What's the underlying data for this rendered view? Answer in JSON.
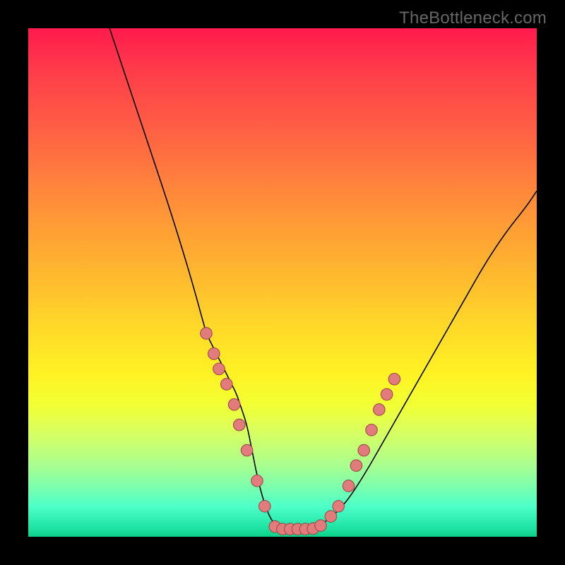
{
  "watermark": "TheBottleneck.com",
  "colors": {
    "background": "#000000",
    "curve": "#000000",
    "dot_fill": "#e27b7c",
    "dot_stroke": "#9c4a4a",
    "gradient_top": "#ff1a4d",
    "gradient_bottom": "#0dd189"
  },
  "chart_data": {
    "type": "line",
    "title": "",
    "xlabel": "",
    "ylabel": "",
    "xlim": [
      0,
      100
    ],
    "ylim": [
      0,
      100
    ],
    "series": [
      {
        "name": "bottleneck-curve",
        "x": [
          16,
          20,
          24,
          28,
          32,
          35,
          35.5,
          36,
          37,
          38,
          39,
          40,
          41,
          42,
          43,
          44,
          45,
          46,
          47,
          48,
          49,
          50,
          52,
          55,
          58,
          62,
          66,
          70,
          74,
          78,
          82,
          86,
          90,
          94,
          98,
          100
        ],
        "values": [
          100,
          88,
          76,
          64,
          51,
          40,
          39,
          38,
          36,
          34,
          32,
          30,
          28,
          25,
          22,
          17,
          12,
          8,
          5,
          3,
          2,
          1.5,
          1.5,
          1.5,
          2.5,
          6,
          12,
          19,
          26,
          33,
          40,
          47,
          54,
          60,
          65,
          68
        ]
      }
    ],
    "points": [
      {
        "name": "left-dot-1",
        "x": 35.0,
        "y": 40
      },
      {
        "name": "left-dot-2",
        "x": 36.5,
        "y": 36
      },
      {
        "name": "left-dot-3",
        "x": 37.5,
        "y": 33
      },
      {
        "name": "left-dot-4",
        "x": 39.0,
        "y": 30
      },
      {
        "name": "left-dot-5",
        "x": 40.5,
        "y": 26
      },
      {
        "name": "left-dot-6",
        "x": 41.5,
        "y": 22
      },
      {
        "name": "left-dot-7",
        "x": 43.0,
        "y": 17
      },
      {
        "name": "left-dot-8",
        "x": 45.0,
        "y": 11
      },
      {
        "name": "left-dot-9",
        "x": 46.5,
        "y": 6
      },
      {
        "name": "flat-dot-1",
        "x": 48.5,
        "y": 2
      },
      {
        "name": "flat-dot-2",
        "x": 50.0,
        "y": 1.5
      },
      {
        "name": "flat-dot-3",
        "x": 51.5,
        "y": 1.5
      },
      {
        "name": "flat-dot-4",
        "x": 53.0,
        "y": 1.5
      },
      {
        "name": "flat-dot-5",
        "x": 54.5,
        "y": 1.5
      },
      {
        "name": "flat-dot-6",
        "x": 56.0,
        "y": 1.6
      },
      {
        "name": "flat-dot-7",
        "x": 57.5,
        "y": 2.2
      },
      {
        "name": "right-dot-1",
        "x": 59.5,
        "y": 4
      },
      {
        "name": "right-dot-2",
        "x": 61.0,
        "y": 6
      },
      {
        "name": "right-dot-3",
        "x": 63.0,
        "y": 10
      },
      {
        "name": "right-dot-4",
        "x": 64.5,
        "y": 14
      },
      {
        "name": "right-dot-5",
        "x": 66.0,
        "y": 17
      },
      {
        "name": "right-dot-6",
        "x": 67.5,
        "y": 21
      },
      {
        "name": "right-dot-7",
        "x": 69.0,
        "y": 25
      },
      {
        "name": "right-dot-8",
        "x": 70.5,
        "y": 28
      },
      {
        "name": "right-dot-9",
        "x": 72.0,
        "y": 31
      }
    ]
  }
}
